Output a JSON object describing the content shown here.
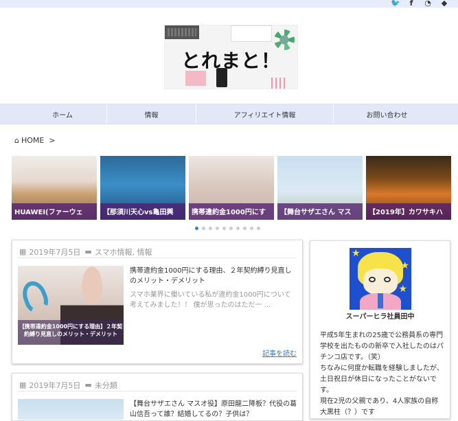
{
  "site": {
    "logo_text": "とれまと！"
  },
  "social": {
    "icons": [
      "twitter-icon",
      "facebook-icon",
      "rss-icon",
      "feedly-icon"
    ]
  },
  "nav": {
    "items": [
      "ホーム",
      "情報",
      "アフィリエイト情報",
      "お問い合わせ"
    ]
  },
  "breadcrumb": {
    "home": "HOME",
    "sep": ">"
  },
  "carousel": {
    "slides": [
      "HUAWEI(ファーウェ",
      "【那須川天心vs亀田興",
      "携帯違約金1000円にす",
      "【舞台サザエさん マス",
      "【2019年】カワサキハ"
    ],
    "pages": 10,
    "active": 0
  },
  "posts": [
    {
      "date": "2019年7月5日",
      "categories": "スマホ情報, 情報",
      "title": "携帯違約金1000円にする理由、２年契約縛り見直しのメリット・デメリット",
      "excerpt": "スマホ業界に働いている私が違約金1000円について考えてみました！！ 僕が思ったのはただ一 ...",
      "thumb_caption": "【携帯違約金1000円にする理由】２年契約縛り見直しのメリット・デメリット",
      "readmore": "記事を読む"
    },
    {
      "date": "2019年7月5日",
      "categories": "未分類",
      "title": "【舞台サザエさん マスオ役】原田龍二降板？代役の葛山信吾って誰？結婚してるの？子供は？"
    }
  ],
  "sidebar": {
    "name": "スーパーヒラ社員田中",
    "text": "平成5年生まれの25歳で公務員系の専門学校を出たものの新卒で入社したのはパチンコ店です。（笑）\nちなみに何度か転職を経験しましたが、土日祝日が休日になったことがないです。\n現在2児の父親であり、4人家族の自称大黒柱（？）です"
  }
}
